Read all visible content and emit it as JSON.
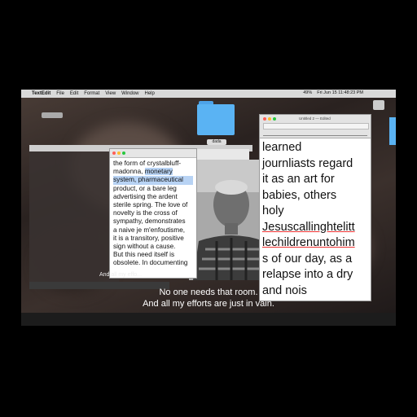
{
  "menubar": {
    "app": "TextEdit",
    "items": [
      "File",
      "Edit",
      "Format",
      "View",
      "Window",
      "Help"
    ],
    "clock": "Fri Jun 15 11:48:23 PM",
    "battery": "49%"
  },
  "desktop": {
    "folder_label": "dada"
  },
  "left_document": {
    "lines": [
      {
        "text": "the form of crystalbluff-",
        "hl": false
      },
      {
        "text": "madonna, monetary",
        "hl": true
      },
      {
        "text": "system, pharmaceutical",
        "hl": true
      },
      {
        "text": "product, or a bare leg",
        "hl": false
      },
      {
        "text": "advertising the ardent",
        "hl": false
      },
      {
        "text": "sterile spring. The love of",
        "hl": false
      },
      {
        "text": "novelty is the cross of",
        "hl": false
      },
      {
        "text": "sympathy, demonstrates",
        "hl": false
      },
      {
        "text": "a naive je m'enfoutisme,",
        "hl": false
      },
      {
        "text": "it is a transitory, positive",
        "hl": false
      },
      {
        "text": "sign without a cause.",
        "hl": false
      },
      {
        "text": "But this need itself is",
        "hl": false
      },
      {
        "text": "obsolete. In documenting",
        "hl": false
      }
    ]
  },
  "left_caption": "And all my effo...",
  "right_document": {
    "title": "Untitled 2 — Edited",
    "lines": [
      {
        "text": "learned",
        "u": false
      },
      {
        "text": "journliasts regard",
        "u": false
      },
      {
        "text": "it as an art for",
        "u": false
      },
      {
        "text": "babies, others",
        "u": false
      },
      {
        "text": "holy",
        "u": false
      },
      {
        "text": "Jesuscallinghtelitt",
        "u": true
      },
      {
        "text": "lechildrenuntohim",
        "u": true
      },
      {
        "text": "s of our day, as a",
        "u": false
      },
      {
        "text": "relapse into a dry",
        "u": false
      },
      {
        "text": "and nois",
        "u": false
      }
    ]
  },
  "subtitles": {
    "line1": "No one needs that room.",
    "line2": "And all my efforts are just in vain."
  },
  "colors": {
    "folder": "#5ab3f3",
    "highlight": "#b8d3f4"
  }
}
